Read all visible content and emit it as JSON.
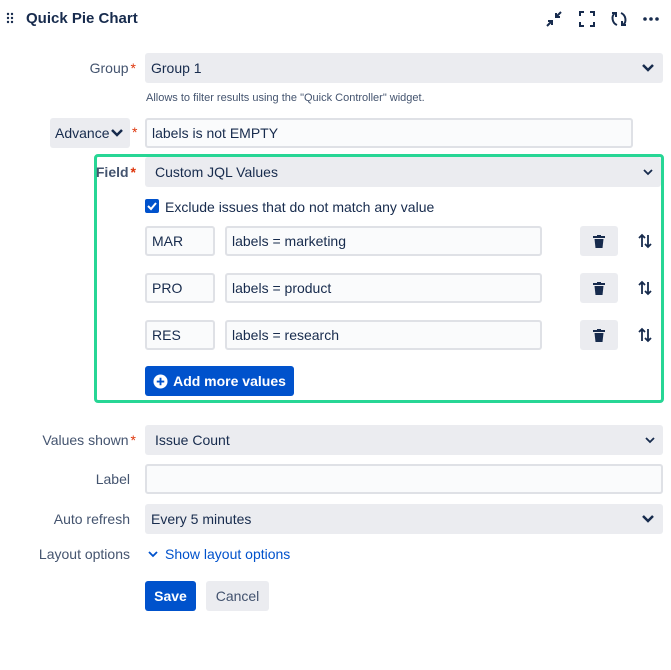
{
  "header": {
    "title": "Quick Pie Chart",
    "icons": [
      "drag-handle-icon",
      "collapse-icon",
      "fullscreen-icon",
      "refresh-icon",
      "more-icon"
    ]
  },
  "group": {
    "label": "Group",
    "value": "Group 1",
    "hint": "Allows to filter results using the \"Quick Controller\" widget."
  },
  "advanced": {
    "mode_label": "Advance",
    "query": "labels is not EMPTY"
  },
  "field": {
    "label": "Field",
    "value": "Custom JQL Values",
    "exclude_label": "Exclude issues that do not match any value",
    "exclude_checked": true,
    "rows": [
      {
        "name": "MAR",
        "jql": "labels = marketing"
      },
      {
        "name": "PRO",
        "jql": "labels = product"
      },
      {
        "name": "RES",
        "jql": "labels = research"
      }
    ],
    "add_label": "Add more values"
  },
  "values_shown": {
    "label": "Values shown",
    "value": "Issue Count"
  },
  "label_field": {
    "label": "Label",
    "value": ""
  },
  "auto_refresh": {
    "label": "Auto refresh",
    "value": "Every 5 minutes"
  },
  "layout_options": {
    "label": "Layout options",
    "link": "Show layout options"
  },
  "actions": {
    "save": "Save",
    "cancel": "Cancel"
  },
  "colors": {
    "accent": "#0052cc",
    "highlight_border": "#27d695",
    "required": "#de350b"
  }
}
